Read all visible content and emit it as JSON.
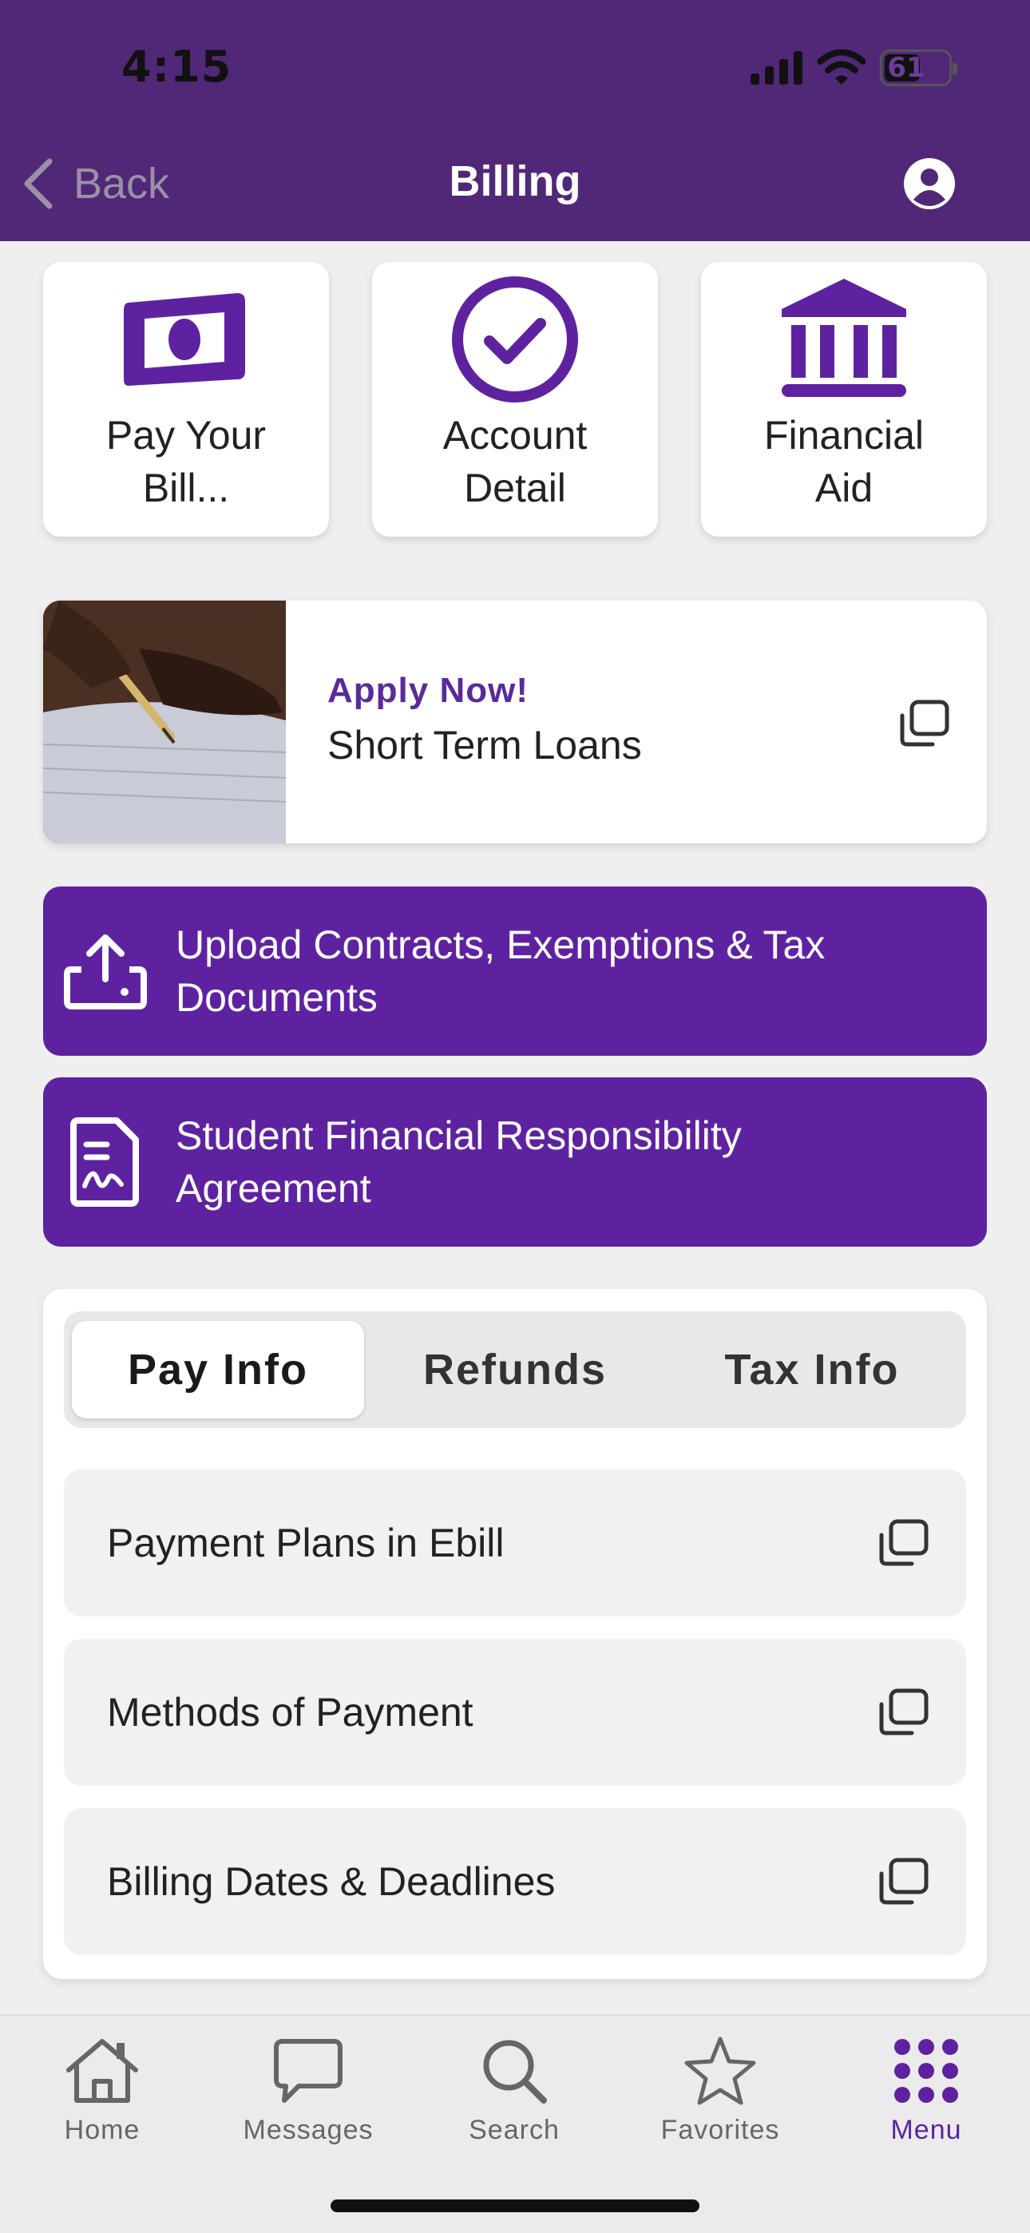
{
  "status_bar": {
    "time": "4:15",
    "battery": "61"
  },
  "header": {
    "back_label": "Back",
    "title": "Billing"
  },
  "quick_links": [
    {
      "label_line1": "Pay Your",
      "label_line2": "Bill...",
      "icon": "money-icon"
    },
    {
      "label_line1": "Account",
      "label_line2": "Detail",
      "icon": "check-circle-icon"
    },
    {
      "label_line1": "Financial",
      "label_line2": "Aid",
      "icon": "bank-icon"
    }
  ],
  "loan_banner": {
    "eyebrow": "Apply Now!",
    "title": "Short Term Loans"
  },
  "actions": [
    {
      "label": "Upload Contracts, Exemptions & Tax Documents",
      "icon": "upload-icon"
    },
    {
      "label": "Student Financial Responsibility Agreement",
      "icon": "document-signature-icon"
    }
  ],
  "tabs": [
    {
      "label": "Pay Info",
      "active": true
    },
    {
      "label": "Refunds",
      "active": false
    },
    {
      "label": "Tax Info",
      "active": false
    }
  ],
  "pay_info_items": [
    {
      "label": "Payment Plans in Ebill"
    },
    {
      "label": "Methods of Payment"
    },
    {
      "label": "Billing Dates & Deadlines"
    }
  ],
  "bottom_nav": [
    {
      "label": "Home",
      "icon": "home-icon"
    },
    {
      "label": "Messages",
      "icon": "chat-bubble-icon"
    },
    {
      "label": "Search",
      "icon": "search-icon"
    },
    {
      "label": "Favorites",
      "icon": "star-icon"
    },
    {
      "label": "Menu",
      "icon": "grid-dots-icon",
      "active": true
    }
  ],
  "colors": {
    "header": "#512878",
    "accent": "#5e22a1",
    "background": "#efefef"
  }
}
